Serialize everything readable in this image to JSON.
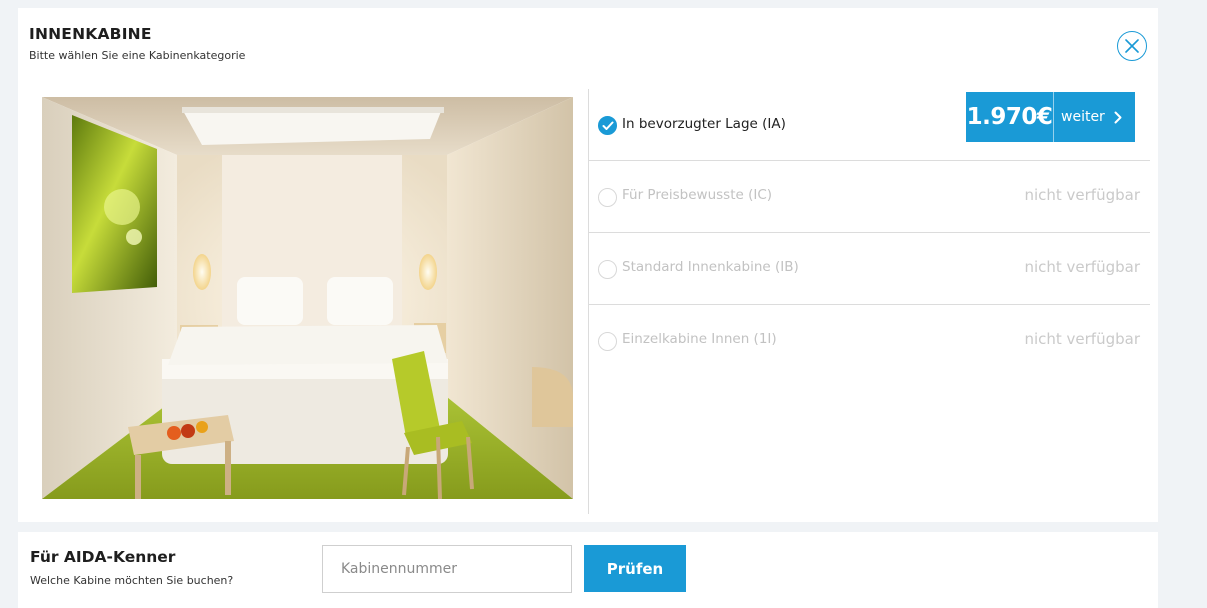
{
  "cabin": {
    "title": "INNENKABINE",
    "subtitle": "Bitte wählen Sie eine Kabinenkategorie",
    "options": [
      {
        "label": "In bevorzugter Lage (IA)",
        "selected": true,
        "price": "1.970€",
        "action_label": "weiter"
      },
      {
        "label": "Für Preisbewusste (IC)",
        "selected": false,
        "status": "nicht verfügbar"
      },
      {
        "label": "Standard Innenkabine (IB)",
        "selected": false,
        "status": "nicht verfügbar"
      },
      {
        "label": "Einzelkabine Innen (1I)",
        "selected": false,
        "status": "nicht verfügbar"
      }
    ]
  },
  "kenner": {
    "title": "Für AIDA-Kenner",
    "subtitle": "Welche Kabine möchten Sie buchen?",
    "input_placeholder": "Kabinennummer",
    "button_label": "Prüfen"
  },
  "colors": {
    "accent": "#1a9ad6",
    "page_background": "#f0f3f6"
  },
  "icons": {
    "close": "close-icon",
    "selected": "check-icon",
    "next": "chevron-right-icon"
  }
}
